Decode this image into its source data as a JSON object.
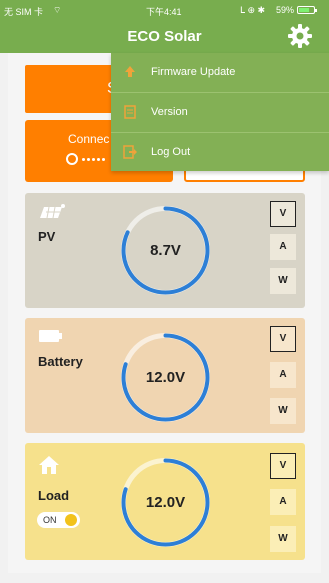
{
  "status_bar": {
    "carrier": "无 SIM 卡 ",
    "wifi_glyph": "⌔",
    "time": "下午4:41",
    "indicators": "ᒪ ⊕ ✱",
    "battery_percent": "59%",
    "battery_level": 0.59
  },
  "header": {
    "title": "ECO Solar",
    "settings_icon": "gear-icon"
  },
  "menu": {
    "items": [
      {
        "label": "Firmware Update",
        "icon": "upload-icon"
      },
      {
        "label": "Version",
        "icon": "document-icon"
      },
      {
        "label": "Log Out",
        "icon": "logout-icon"
      }
    ]
  },
  "controls": {
    "top_button_visible_label": "S",
    "connect_label": "Connec"
  },
  "cards": [
    {
      "name": "PV",
      "icon": "solar-panel-icon",
      "value": "8.7V",
      "units": [
        "V",
        "A",
        "W"
      ],
      "active_unit": "V",
      "gauge_fraction": 0.82,
      "color": "#d8d4c7"
    },
    {
      "name": "Battery",
      "icon": "battery-icon",
      "value": "12.0V",
      "units": [
        "V",
        "A",
        "W"
      ],
      "active_unit": "V",
      "gauge_fraction": 0.8,
      "color": "#f0d5b1"
    },
    {
      "name": "Load",
      "icon": "home-icon",
      "value": "12.0V",
      "units": [
        "V",
        "A",
        "W"
      ],
      "active_unit": "V",
      "gauge_fraction": 0.8,
      "color": "#f6e18c",
      "toggle_label": "ON",
      "toggle_on": true
    }
  ],
  "colors": {
    "accent_green": "#78ad4e",
    "menu_green": "#83b055",
    "orange": "#ff7f00",
    "gauge_blue": "#2d7fd6"
  }
}
